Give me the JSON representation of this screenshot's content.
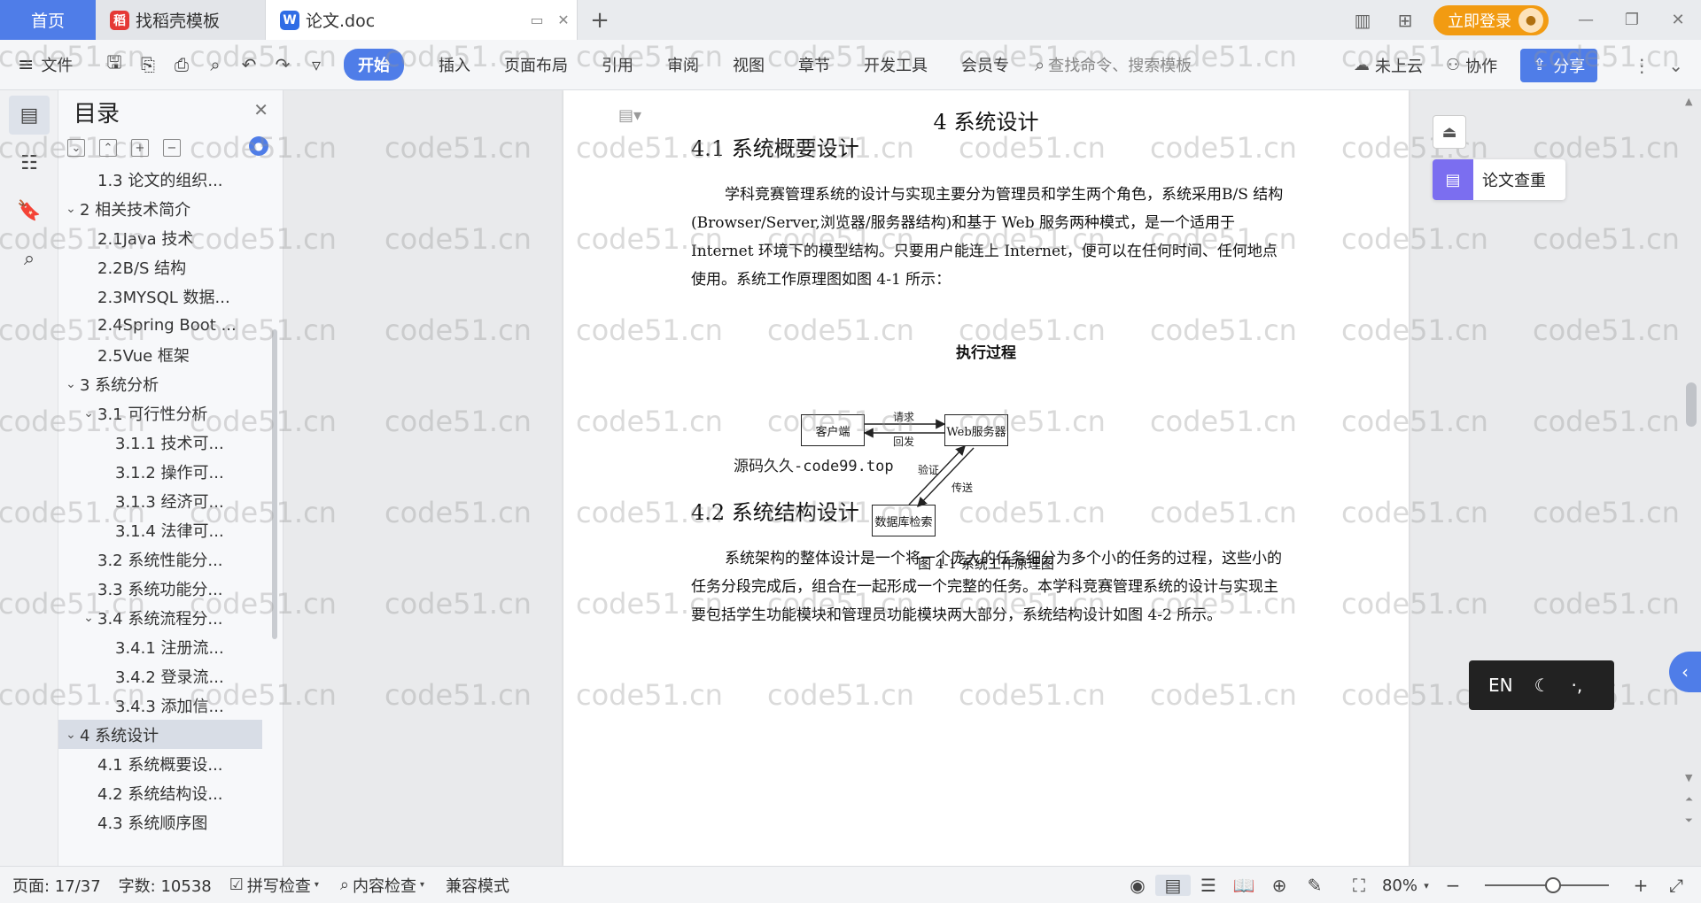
{
  "titlebar": {
    "home_tab": "首页",
    "tabs": [
      {
        "label": "找稻壳模板",
        "icon": "docer-icon"
      },
      {
        "label": "论文.doc",
        "icon": "word-icon"
      }
    ],
    "login_label": "立即登录"
  },
  "ribbon": {
    "file_menu": "文件",
    "tabs": [
      "开始",
      "插入",
      "页面布局",
      "引用",
      "审阅",
      "视图",
      "章节",
      "开发工具",
      "会员专"
    ],
    "search_placeholder": "查找命令、搜索模板",
    "cloud_label": "未上云",
    "collab_label": "协作",
    "share_label": "分享"
  },
  "toc": {
    "title": "目录",
    "items": [
      {
        "label": "1.3 论文的组织...",
        "level": 2
      },
      {
        "label": "2  相关技术简介",
        "level": 1,
        "expanded": true
      },
      {
        "label": "2.1Java 技术",
        "level": 2
      },
      {
        "label": "2.2B/S 结构",
        "level": 2
      },
      {
        "label": "2.3MYSQL 数据...",
        "level": 2
      },
      {
        "label": "2.4Spring Boot ...",
        "level": 2
      },
      {
        "label": "2.5Vue 框架",
        "level": 2
      },
      {
        "label": "3  系统分析",
        "level": 1,
        "expanded": true
      },
      {
        "label": "3.1 可行性分析",
        "level": 2,
        "expanded": true
      },
      {
        "label": "3.1.1 技术可...",
        "level": 3
      },
      {
        "label": "3.1.2 操作可...",
        "level": 3
      },
      {
        "label": "3.1.3 经济可...",
        "level": 3
      },
      {
        "label": "3.1.4 法律可...",
        "level": 3
      },
      {
        "label": "3.2 系统性能分...",
        "level": 2
      },
      {
        "label": "3.3 系统功能分...",
        "level": 2
      },
      {
        "label": "3.4 系统流程分...",
        "level": 2,
        "expanded": true
      },
      {
        "label": "3.4.1 注册流...",
        "level": 3
      },
      {
        "label": "3.4.2 登录流...",
        "level": 3
      },
      {
        "label": "3.4.3 添加信...",
        "level": 3
      },
      {
        "label": "4  系统设计",
        "level": 1,
        "expanded": true,
        "selected": true
      },
      {
        "label": "4.1 系统概要设...",
        "level": 2
      },
      {
        "label": "4.2 系统结构设...",
        "level": 2
      },
      {
        "label": "4.3  系统顺序图",
        "level": 2
      }
    ]
  },
  "document": {
    "chapter_title": "4  系统设计",
    "section1_title": "4.1 系统概要设计",
    "section1_text": "学科竞赛管理系统的设计与实现主要分为管理员和学生两个角色，系统采用B/S 结构(Browser/Server,浏览器/服务器结构)和基于 Web 服务两种模式，是一个适用于 Internet 环境下的模型结构。只要用户能连上 Internet，便可以在任何时间、任何地点使用。系统工作原理图如图 4-1 所示：",
    "figure_title": "执行过程",
    "figure_overlay_text": "源码久久-code99.top",
    "diagram": {
      "client": "客户端",
      "web_server": "Web服务器",
      "db": "数据库检索",
      "request": "请求",
      "response": "回发",
      "verify": "验证",
      "transmit": "传送"
    },
    "figure_caption": "图 4-1  系统工作原理图",
    "section2_title": "4.2 系统结构设计",
    "section2_text": "系统架构的整体设计是一个将一个庞大的任务细分为多个小的任务的过程，这些小的任务分段完成后，组合在一起形成一个完整的任务。本学科竞赛管理系统的设计与实现主要包括学生功能模块和管理员功能模块两大部分，系统结构设计如图 4-2 所示。"
  },
  "watermark": "code51.cn",
  "right_panel": {
    "check_label": "论文查重",
    "ime_lang": "EN"
  },
  "statusbar": {
    "page": "页面: 17/37",
    "words": "字数: 10538",
    "spell": "拼写检查",
    "content_check": "内容检查",
    "compat": "兼容模式",
    "zoom": "80%",
    "zoom_fraction": 0.55
  },
  "colors": {
    "accent": "#4f7de8",
    "login": "#f29b12",
    "check_icon": "#7b6ef0"
  }
}
